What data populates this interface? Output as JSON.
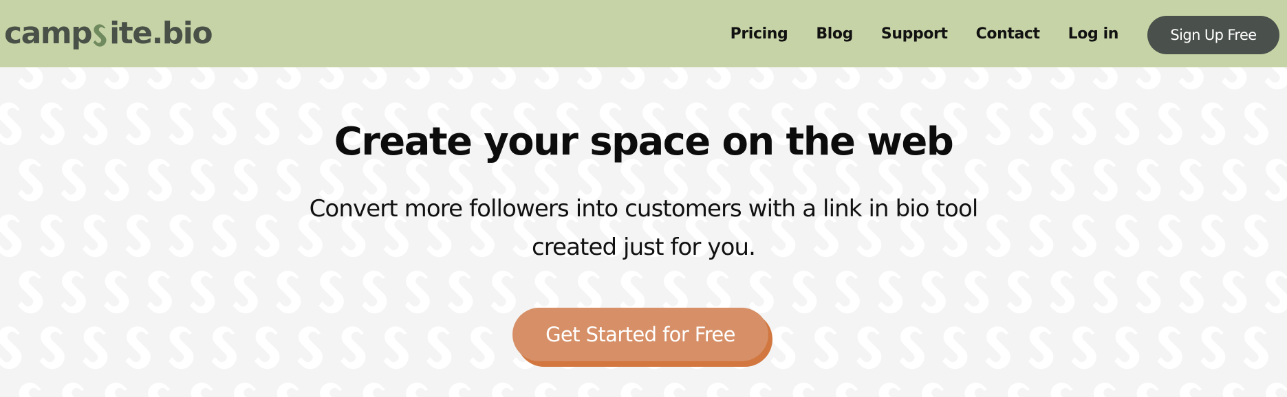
{
  "brand": {
    "name_before": "camp",
    "name_after": "ite.bio",
    "logo_icon": "chain-link-s-icon",
    "text_color": "#485047",
    "accent_color": "#6f8a5e"
  },
  "header": {
    "background": "#c6d3a6",
    "nav": [
      {
        "label": "Pricing"
      },
      {
        "label": "Blog"
      },
      {
        "label": "Support"
      },
      {
        "label": "Contact"
      },
      {
        "label": "Log in"
      }
    ],
    "signup_label": "Sign Up Free",
    "signup_color": "#4a504b"
  },
  "hero": {
    "title": "Create your space on the web",
    "subtitle_line1": "Convert more followers into customers with a link in bio tool",
    "subtitle_line2": "created just for you.",
    "cta_label": "Get Started for Free",
    "cta_color": "#d68f66",
    "cta_shadow_color": "#d1773f",
    "background": "#f4f4f4",
    "pattern_icon": "chain-link-s-icon"
  }
}
